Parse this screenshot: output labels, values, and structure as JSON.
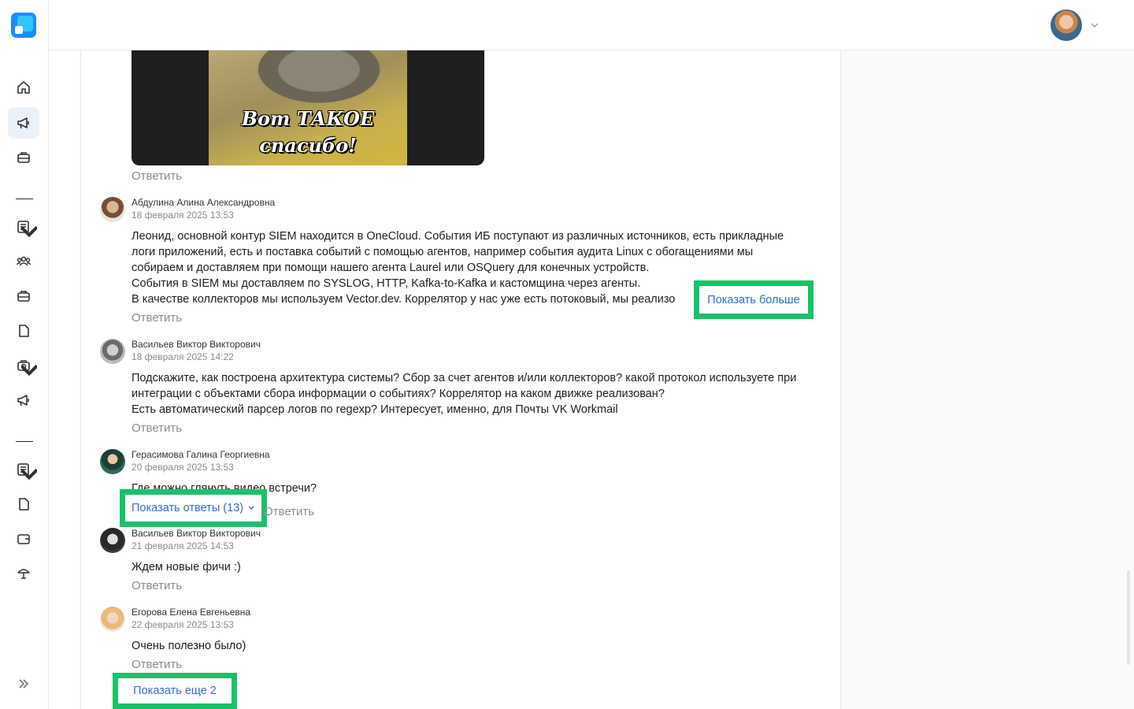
{
  "image": {
    "caption_line1": "Вот ТАКОЕ",
    "caption_line2": "спасибо!"
  },
  "reply_label": "Ответить",
  "comments": [
    {
      "author": "Абдулина Алина Александровна",
      "date": "18 февраля 2025 13:53",
      "lines": [
        "Леонид, основной контур SIEM находится в OneCloud. События ИБ поступают из различных источников, есть прикладные",
        "логи приложений, есть и поставка событий с помощью агентов, например события аудита Linux с обогащениями мы",
        "собираем и доставляем при помощи нашего агента Laurel или OSQuery для конечных устройств.",
        "События в SIEM мы доставляем по SYSLOG, HTTP, Kafka-to-Kafka и кастомщина через агенты.",
        "В качестве коллекторов мы используем Vector.dev. Коррелятор у нас уже есть потоковый, мы реализо"
      ],
      "show_more": "Показать больше"
    },
    {
      "author": "Васильев Виктор Викторович",
      "date": "18 февраля 2025 14:22",
      "lines": [
        "Подскажите, как построена архитектура системы? Сбор за счет агентов и/или коллекторов? какой протокол используете при",
        "интеграции с объектами сбора информации о событиях? Коррелятор на каком движке реализован?",
        "Есть автоматический парсер логов по regexp? Интересует, именно, для Почты VK Workmail"
      ]
    },
    {
      "author": "Герасимова Галина Георгиевна",
      "date": "20 февраля 2025 13:53",
      "lines": [
        "Где можно глянуть видео встречи?"
      ],
      "show_replies": "Показать ответы (13)"
    },
    {
      "author": "Васильев Виктор Викторович",
      "date": "21 февраля 2025 14:53",
      "lines": [
        "Ждем новые фичи :)"
      ]
    },
    {
      "author": "Егорова Елена Евгеньевна",
      "date": "22 февраля 2025 13:53",
      "lines": [
        "Очень полезно было)"
      ]
    }
  ],
  "show_more_comments": "Показать еще 2",
  "colors": {
    "accent": "#2f6fd6",
    "highlight": "#19c26a",
    "active_nav_bg": "#eaf1fb"
  },
  "sidebar_icons": [
    "home-icon",
    "megaphone-icon",
    "briefcase-icon",
    "document-list-icon",
    "people-icon",
    "briefcase-icon",
    "file-icon",
    "robot-icon",
    "megaphone-icon",
    "document-list-icon",
    "file-icon",
    "wallet-icon",
    "umbrella-icon",
    "expand-icon"
  ]
}
